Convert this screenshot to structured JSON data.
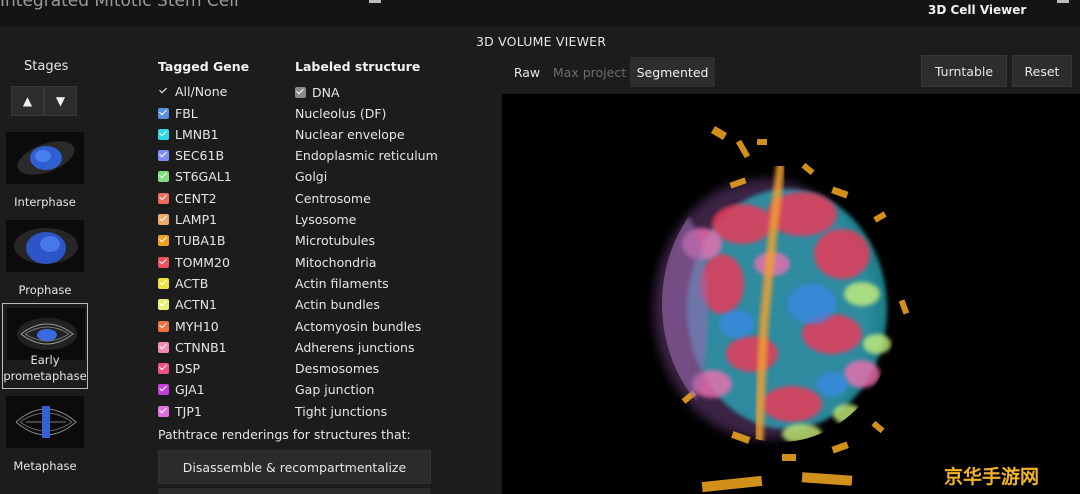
{
  "app": {
    "title": "Integrated Mitotic Stem Cell",
    "viewer_badge": "3D Cell Viewer"
  },
  "stages": {
    "title": "Stages",
    "up_icon": "arrow-up-icon",
    "down_icon": "arrow-down-icon",
    "items": [
      {
        "label": "Interphase",
        "selected": false
      },
      {
        "label": "Prophase",
        "selected": false
      },
      {
        "label": "Early prometaphase",
        "selected": true
      },
      {
        "label": "Metaphase",
        "selected": false
      }
    ]
  },
  "genes": {
    "header_gene": "Tagged Gene",
    "header_structure": "Labeled structure",
    "all_none": "All/None",
    "dna_label": "DNA",
    "rows": [
      {
        "gene": "FBL",
        "structure": "Nucleolus (DF)",
        "color": "#5a8fe0"
      },
      {
        "gene": "LMNB1",
        "structure": "Nuclear envelope",
        "color": "#2fd6e6"
      },
      {
        "gene": "SEC61B",
        "structure": "Endoplasmic reticulum",
        "color": "#7f8ef2"
      },
      {
        "gene": "ST6GAL1",
        "structure": "Golgi",
        "color": "#7ee07e"
      },
      {
        "gene": "CENT2",
        "structure": "Centrosome",
        "color": "#f06a5a"
      },
      {
        "gene": "LAMP1",
        "structure": "Lysosome",
        "color": "#f0a868"
      },
      {
        "gene": "TUBA1B",
        "structure": "Microtubules",
        "color": "#f0a020"
      },
      {
        "gene": "TOMM20",
        "structure": "Mitochondria",
        "color": "#f0505a"
      },
      {
        "gene": "ACTB",
        "structure": "Actin filaments",
        "color": "#f0e040"
      },
      {
        "gene": "ACTN1",
        "structure": "Actin bundles",
        "color": "#e8f07a"
      },
      {
        "gene": "MYH10",
        "structure": "Actomyosin bundles",
        "color": "#f07040"
      },
      {
        "gene": "CTNNB1",
        "structure": "Adherens junctions",
        "color": "#f08ab0"
      },
      {
        "gene": "DSP",
        "structure": "Desmosomes",
        "color": "#f0508a"
      },
      {
        "gene": "GJA1",
        "structure": "Gap junction",
        "color": "#c040d8"
      },
      {
        "gene": "TJP1",
        "structure": "Tight junctions",
        "color": "#e070e0"
      }
    ],
    "pathtrace_label": "Pathtrace renderings for structures that:",
    "disassemble_label": "Disassemble & recompartmentalize"
  },
  "viewer": {
    "title": "3D VOLUME VIEWER",
    "modes": {
      "raw": "Raw",
      "max": "Max project",
      "seg": "Segmented"
    },
    "active_mode": "Segmented",
    "turntable_label": "Turntable",
    "reset_label": "Reset"
  },
  "watermark": "京华手游网"
}
